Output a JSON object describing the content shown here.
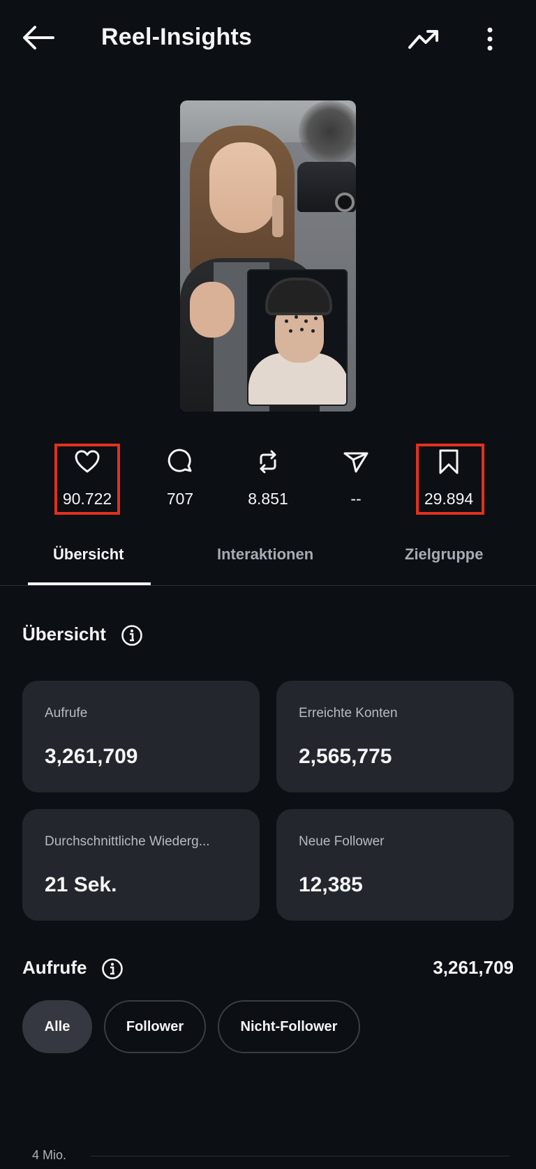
{
  "header": {
    "title": "Reel-Insights"
  },
  "stats": {
    "likes": "90.722",
    "comments": "707",
    "reposts": "8.851",
    "shares": "--",
    "saves": "29.894"
  },
  "tabs": [
    {
      "label": "Übersicht",
      "active": true
    },
    {
      "label": "Interaktionen",
      "active": false
    },
    {
      "label": "Zielgruppe",
      "active": false
    }
  ],
  "overview": {
    "title": "Übersicht",
    "cards": [
      {
        "label": "Aufrufe",
        "value": "3,261,709"
      },
      {
        "label": "Erreichte Konten",
        "value": "2,565,775"
      },
      {
        "label": "Durchschnittliche Wiederg...",
        "value": "21 Sek."
      },
      {
        "label": "Neue Follower",
        "value": "12,385"
      }
    ]
  },
  "views": {
    "title": "Aufrufe",
    "total": "3,261,709",
    "filters": [
      "Alle",
      "Follower",
      "Nicht-Follower"
    ],
    "active_filter": "Alle",
    "axis_top_label": "4 Mio."
  },
  "colors": {
    "background": "#0c0f14",
    "card": "#23262c",
    "highlight": "#e3301d"
  }
}
